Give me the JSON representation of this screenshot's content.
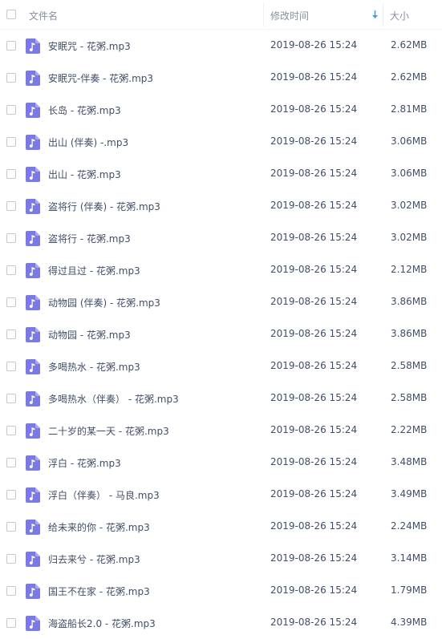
{
  "header": {
    "name_label": "文件名",
    "time_label": "修改时间",
    "size_label": "大小",
    "sort_icon": "sort-down-arrow-icon"
  },
  "colors": {
    "icon_bg": "#7b79e5",
    "sort_arrow": "#3f9ad8",
    "text": "#424e67",
    "header_text": "#888f9f"
  },
  "files": [
    {
      "name": "安眠咒 - 花粥.mp3",
      "time": "2019-08-26 15:24",
      "size": "2.62MB"
    },
    {
      "name": "安眠咒-伴奏 - 花粥.mp3",
      "time": "2019-08-26 15:24",
      "size": "2.62MB"
    },
    {
      "name": "长岛 - 花粥.mp3",
      "time": "2019-08-26 15:24",
      "size": "2.81MB"
    },
    {
      "name": "出山 (伴奏) -.mp3",
      "time": "2019-08-26 15:24",
      "size": "3.06MB"
    },
    {
      "name": "出山 - 花粥.mp3",
      "time": "2019-08-26 15:24",
      "size": "3.06MB"
    },
    {
      "name": "盗将行 (伴奏) - 花粥.mp3",
      "time": "2019-08-26 15:24",
      "size": "3.02MB"
    },
    {
      "name": "盗将行 - 花粥.mp3",
      "time": "2019-08-26 15:24",
      "size": "3.02MB"
    },
    {
      "name": "得过且过 - 花粥.mp3",
      "time": "2019-08-26 15:24",
      "size": "2.12MB"
    },
    {
      "name": "动物园 (伴奏) - 花粥.mp3",
      "time": "2019-08-26 15:24",
      "size": "3.86MB"
    },
    {
      "name": "动物园 - 花粥.mp3",
      "time": "2019-08-26 15:24",
      "size": "3.86MB"
    },
    {
      "name": "多喝热水 - 花粥.mp3",
      "time": "2019-08-26 15:24",
      "size": "2.58MB"
    },
    {
      "name": "多喝热水（伴奏） - 花粥.mp3",
      "time": "2019-08-26 15:24",
      "size": "2.58MB"
    },
    {
      "name": "二十岁的某一天 - 花粥.mp3",
      "time": "2019-08-26 15:24",
      "size": "2.22MB"
    },
    {
      "name": "浮白 - 花粥.mp3",
      "time": "2019-08-26 15:24",
      "size": "3.48MB"
    },
    {
      "name": "浮白（伴奏） - 马良.mp3",
      "time": "2019-08-26 15:24",
      "size": "3.49MB"
    },
    {
      "name": "给未来的你 - 花粥.mp3",
      "time": "2019-08-26 15:24",
      "size": "2.24MB"
    },
    {
      "name": "归去来兮 - 花粥.mp3",
      "time": "2019-08-26 15:24",
      "size": "3.14MB"
    },
    {
      "name": "国王不在家 - 花粥.mp3",
      "time": "2019-08-26 15:24",
      "size": "1.79MB"
    },
    {
      "name": "海盗船长2.0 - 花粥.mp3",
      "time": "2019-08-26 15:24",
      "size": "4.39MB"
    }
  ]
}
